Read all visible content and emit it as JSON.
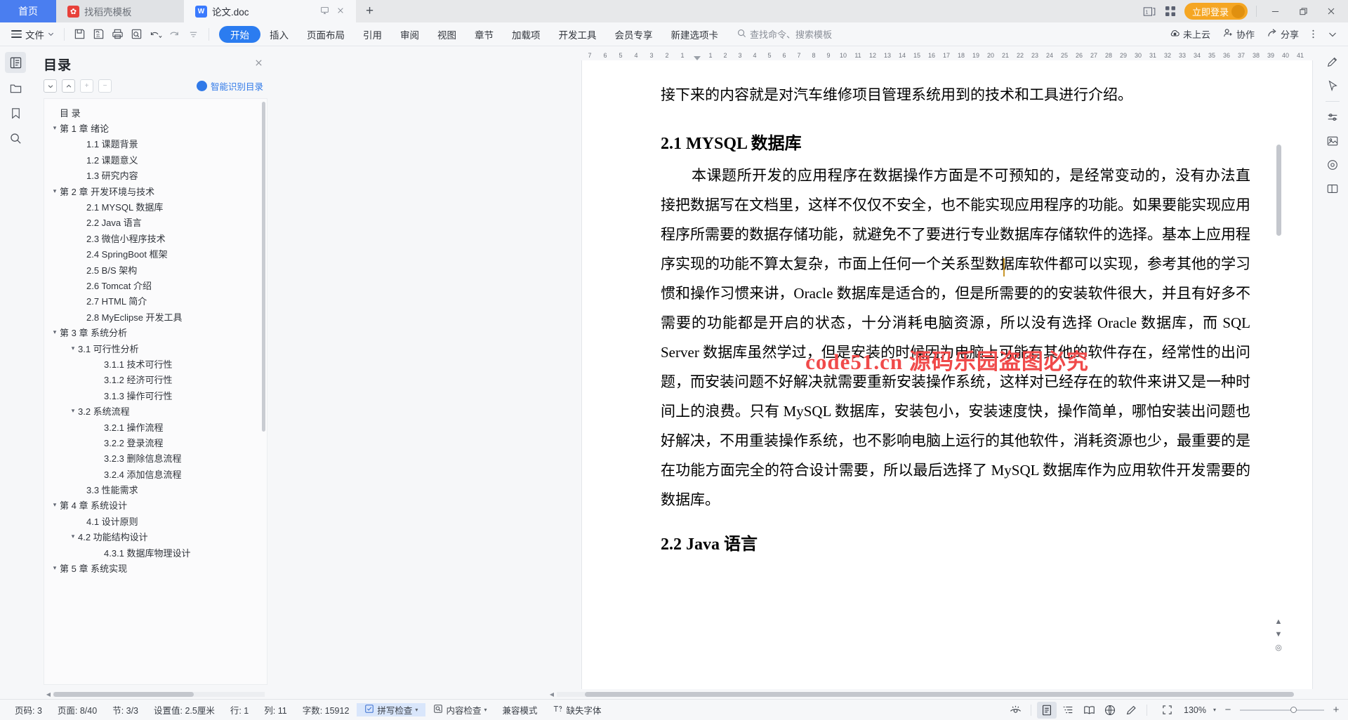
{
  "tabbar": {
    "home_label": "首页",
    "tabs": [
      {
        "label": "找稻壳模板",
        "icon": "flower-icon",
        "state": "inactive"
      },
      {
        "label": "论文.doc",
        "icon": "wps-word-icon",
        "state": "active"
      }
    ],
    "tab_actions": {
      "present_icon": "present-icon",
      "close_icon": "close-icon"
    },
    "new_tab_label": "+",
    "right": {
      "page_count_icon": "page-count-icon",
      "page_count_label": "1",
      "grid_icon": "grid-icon",
      "login_label": "立即登录",
      "minimize_label": "–",
      "restore_label": "❐",
      "close_label": "✕"
    }
  },
  "ribbon": {
    "file_label": "文件",
    "quick_icons": [
      "save-icon",
      "save-as-cloud-icon",
      "print-icon",
      "print-preview-icon",
      "undo-icon",
      "redo-icon",
      "customize-icon"
    ],
    "tabs": [
      {
        "label": "开始",
        "selected": true
      },
      {
        "label": "插入",
        "selected": false
      },
      {
        "label": "页面布局",
        "selected": false
      },
      {
        "label": "引用",
        "selected": false
      },
      {
        "label": "审阅",
        "selected": false
      },
      {
        "label": "视图",
        "selected": false
      },
      {
        "label": "章节",
        "selected": false
      },
      {
        "label": "加载项",
        "selected": false
      },
      {
        "label": "开发工具",
        "selected": false
      },
      {
        "label": "会员专享",
        "selected": false
      },
      {
        "label": "新建选项卡",
        "selected": false
      }
    ],
    "search_placeholder": "查找命令、搜索模板",
    "right_items": [
      {
        "label": "未上云",
        "icon": "cloud-icon"
      },
      {
        "label": "协作",
        "icon": "collaborate-icon"
      },
      {
        "label": "分享",
        "icon": "share-icon"
      }
    ],
    "more_icon": "more-vertical-icon",
    "collapse_icon": "chevron-down-icon"
  },
  "left_rail": [
    {
      "icon": "toc-icon",
      "active": true
    },
    {
      "icon": "folder-icon",
      "active": false
    },
    {
      "icon": "bookmark-icon",
      "active": false
    },
    {
      "icon": "search-icon",
      "active": false
    }
  ],
  "nav_pane": {
    "title": "目录",
    "close_icon": "close-icon",
    "tools": [
      {
        "icon": "expand-down-icon",
        "name": "expand-all-button",
        "dim": false
      },
      {
        "icon": "collapse-up-icon",
        "name": "collapse-all-button",
        "dim": false
      },
      {
        "icon": "plus-icon",
        "name": "increase-level-button",
        "dim": true
      },
      {
        "icon": "minus-icon",
        "name": "decrease-level-button",
        "dim": true
      }
    ],
    "smart_label": "智能识别目录",
    "toc": [
      {
        "text": "目  录",
        "level": 1,
        "caret": ""
      },
      {
        "text": "第 1 章 绪论",
        "level": 1,
        "caret": "v"
      },
      {
        "text": "1.1 课题背景",
        "level": 2,
        "caret": ""
      },
      {
        "text": "1.2 课题意义",
        "level": 2,
        "caret": ""
      },
      {
        "text": "1.3 研究内容",
        "level": 2,
        "caret": ""
      },
      {
        "text": "第 2 章 开发环境与技术",
        "level": 1,
        "caret": "v"
      },
      {
        "text": "2.1 MYSQL 数据库",
        "level": 2,
        "caret": ""
      },
      {
        "text": "2.2 Java 语言",
        "level": 2,
        "caret": ""
      },
      {
        "text": "2.3 微信小程序技术",
        "level": 2,
        "caret": ""
      },
      {
        "text": "2.4 SpringBoot 框架",
        "level": 2,
        "caret": ""
      },
      {
        "text": "2.5 B/S 架构",
        "level": 2,
        "caret": ""
      },
      {
        "text": "2.6 Tomcat 介绍",
        "level": 2,
        "caret": ""
      },
      {
        "text": "2.7 HTML 简介",
        "level": 2,
        "caret": ""
      },
      {
        "text": "2.8 MyEclipse 开发工具",
        "level": 2,
        "caret": ""
      },
      {
        "text": "第 3 章 系统分析",
        "level": 1,
        "caret": "v"
      },
      {
        "text": "3.1 可行性分析",
        "level": 2,
        "caret": "v"
      },
      {
        "text": "3.1.1 技术可行性",
        "level": 3,
        "caret": ""
      },
      {
        "text": "3.1.2 经济可行性",
        "level": 3,
        "caret": ""
      },
      {
        "text": "3.1.3 操作可行性",
        "level": 3,
        "caret": ""
      },
      {
        "text": "3.2 系统流程",
        "level": 2,
        "caret": "v"
      },
      {
        "text": "3.2.1 操作流程",
        "level": 3,
        "caret": ""
      },
      {
        "text": "3.2.2 登录流程",
        "level": 3,
        "caret": ""
      },
      {
        "text": "3.2.3 删除信息流程",
        "level": 3,
        "caret": ""
      },
      {
        "text": "3.2.4 添加信息流程",
        "level": 3,
        "caret": ""
      },
      {
        "text": "3.3 性能需求",
        "level": 2,
        "caret": ""
      },
      {
        "text": "第 4 章 系统设计",
        "level": 1,
        "caret": "v"
      },
      {
        "text": "4.1 设计原则",
        "level": 2,
        "caret": ""
      },
      {
        "text": "4.2 功能结构设计",
        "level": 2,
        "caret": "v"
      },
      {
        "text": "4.3.1 数据库物理设计",
        "level": 3,
        "caret": ""
      },
      {
        "text": "第 5 章 系统实现",
        "level": 1,
        "caret": "v"
      }
    ]
  },
  "ruler": {
    "left_ticks": [
      "7",
      "6",
      "5",
      "4",
      "3",
      "2",
      "1"
    ],
    "right_ticks": [
      "1",
      "2",
      "3",
      "4",
      "5",
      "6",
      "7",
      "8",
      "9",
      "10",
      "11",
      "12",
      "13",
      "14",
      "15",
      "16",
      "17",
      "18",
      "19",
      "20",
      "21",
      "22",
      "23",
      "24",
      "25",
      "26",
      "27",
      "28",
      "29",
      "30",
      "31",
      "32",
      "33",
      "34",
      "35",
      "36",
      "37",
      "38",
      "39",
      "40",
      "41"
    ]
  },
  "document": {
    "lead_paragraph": "接下来的内容就是对汽车维修项目管理系统用到的技术和工具进行介绍。",
    "heading": "2.1 MYSQL 数据库",
    "body_paragraph": "本课题所开发的应用程序在数据操作方面是不可预知的，是经常变动的，没有办法直接把数据写在文档里，这样不仅仅不安全，也不能实现应用程序的功能。如果要能实现应用程序所需要的数据存储功能，就避免不了要进行专业数据库存储软件的选择。基本上应用程序实现的功能不算太复杂，市面上任何一个关系型数据库软件都可以实现，参考其他的学习惯和操作习惯来讲，Oracle 数据库是适合的，但是所需要的的安装软件很大，并且有好多不需要的功能都是开启的状态，十分消耗电脑资源，所以没有选择 Oracle 数据库，而 SQL Server 数据库虽然学过，但是安装的时候因为电脑上可能有其他的软件存在，经常性的出问题，而安装问题不好解决就需要重新安装操作系统，这样对已经存在的软件来讲又是一种时间上的浪费。只有 MySQL 数据库，安装包小，安装速度快，操作简单，哪怕安装出问题也好解决，不用重装操作系统，也不影响电脑上运行的其他软件，消耗资源也少，最重要的是在功能方面完全的符合设计需要，所以最后选择了 MySQL 数据库作为应用软件开发需要的数据库。",
    "next_heading": "2.2 Java 语言",
    "watermark": "code51.cn 源码乐园盗图必究",
    "watermark_color": "#f04a4a"
  },
  "right_rail": [
    {
      "icon": "pen-edit-icon"
    },
    {
      "icon": "cursor-select-icon"
    },
    {
      "icon": "divider"
    },
    {
      "icon": "adjust-icon"
    },
    {
      "icon": "image-icon"
    },
    {
      "icon": "target-icon"
    },
    {
      "icon": "screen-split-icon"
    }
  ],
  "status": {
    "items": [
      {
        "label": "页码: 3",
        "name": "page-number"
      },
      {
        "label": "页面: 8/40",
        "name": "page-of-total"
      },
      {
        "label": "节: 3/3",
        "name": "section"
      },
      {
        "label": "设置值: 2.5厘米",
        "name": "measure-value"
      },
      {
        "label": "行: 1",
        "name": "line-number"
      },
      {
        "label": "列: 11",
        "name": "column-number"
      },
      {
        "label": "字数: 15912",
        "name": "word-count"
      }
    ],
    "spellcheck": {
      "label": "拼写检查",
      "icon": "spellcheck-icon",
      "highlighted": true
    },
    "contentcheck": {
      "label": "内容检查",
      "icon": "content-check-icon"
    },
    "compat": {
      "label": "兼容模式",
      "name": "compatibility-mode"
    },
    "missingfont": {
      "label": "缺失字体",
      "icon": "missing-font-icon"
    },
    "view_icons": [
      {
        "icon": "eye-focus-icon",
        "active": false
      },
      {
        "icon": "page-view-icon",
        "active": true
      },
      {
        "icon": "outline-view-icon",
        "active": false
      },
      {
        "icon": "reading-view-icon",
        "active": false
      },
      {
        "icon": "web-view-icon",
        "active": false
      },
      {
        "icon": "pen-view-icon",
        "active": false
      }
    ],
    "zoom_fit_icon": "fit-page-icon",
    "zoom_level": "130%",
    "zoom_out": "−",
    "zoom_in": "+"
  }
}
